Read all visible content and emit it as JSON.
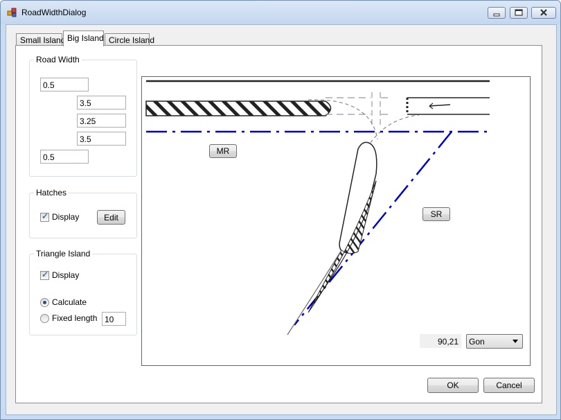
{
  "window": {
    "title": "RoadWidthDialog"
  },
  "tabs": [
    {
      "label": "Small Island"
    },
    {
      "label": "Big Island"
    },
    {
      "label": "Circle Island"
    }
  ],
  "road_width": {
    "title": "Road Width",
    "values": [
      "0.5",
      "3.5",
      "3.25",
      "3.5",
      "0.5"
    ]
  },
  "hatches": {
    "title": "Hatches",
    "display_label": "Display",
    "display_checked": true,
    "edit_label": "Edit"
  },
  "triangle_island": {
    "title": "Triangle Island",
    "display_label": "Display",
    "display_checked": true,
    "calculate_label": "Calculate",
    "fixed_length_label": "Fixed length",
    "selected_mode": "Calculate",
    "fixed_length_value": "10"
  },
  "drawing": {
    "mr_label": "MR",
    "sr_label": "SR",
    "angle_value": "90,21",
    "angle_unit": "Gon",
    "line_color": "#0000c8"
  },
  "footer": {
    "ok_label": "OK",
    "cancel_label": "Cancel"
  }
}
